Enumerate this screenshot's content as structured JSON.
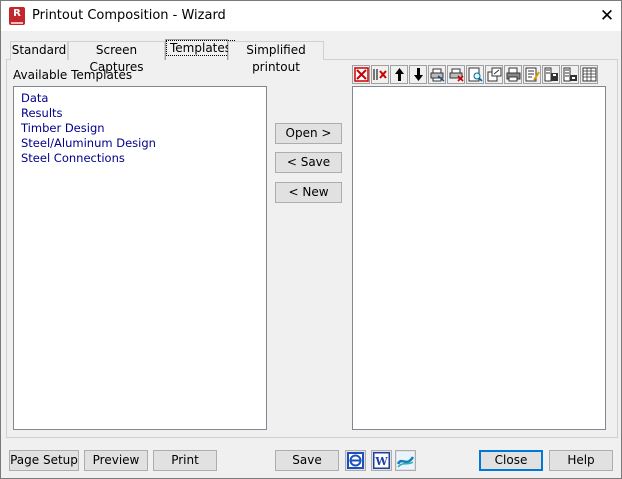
{
  "window": {
    "title": "Printout Composition - Wizard",
    "app_icon_letter": "R"
  },
  "tabs": [
    {
      "label": "Standard"
    },
    {
      "label": "Screen Captures"
    },
    {
      "label": "Templates",
      "active": true
    },
    {
      "label": "Simplified printout"
    }
  ],
  "templates": {
    "heading": "Available Templates",
    "items": [
      "Data",
      "Results",
      "Timber Design",
      "Steel/Aluminum Design",
      "Steel Connections"
    ]
  },
  "middle_buttons": {
    "open": "Open >",
    "save": "< Save",
    "new": "< New"
  },
  "toolbar_icons": [
    "delete-icon",
    "delete-all-icon",
    "move-up-icon",
    "move-down-icon",
    "print-icon",
    "print-delete-icon",
    "preview-icon",
    "export-icon",
    "printer-icon",
    "page-edit-icon",
    "page-save-icon",
    "page-layout-icon",
    "table-icon"
  ],
  "footer": {
    "page_setup": "Page Setup",
    "preview": "Preview",
    "print": "Print",
    "save": "Save",
    "close": "Close",
    "help": "Help",
    "icon_buttons": [
      "html-export-icon",
      "word-export-icon",
      "other-export-icon"
    ]
  },
  "colors": {
    "list_text": "#00008b",
    "accent": "#0078d7",
    "app_icon": "#c4262e"
  }
}
